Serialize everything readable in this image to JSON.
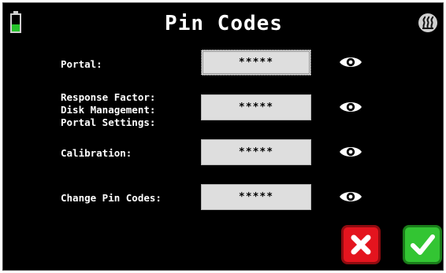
{
  "title": "Pin Codes",
  "status": {
    "battery_level_fraction": 0.45,
    "battery_color": "#26c22b"
  },
  "fields": [
    {
      "label": "Portal:",
      "value": "*****"
    },
    {
      "label": "Response Factor:\nDisk Management:\nPortal Settings:",
      "value": "*****"
    },
    {
      "label": "Calibration:",
      "value": "*****"
    },
    {
      "label": "Change Pin Codes:",
      "value": "*****"
    }
  ],
  "icons": {
    "battery": "battery-icon",
    "heater": "heater-icon",
    "reveal": "eye-icon",
    "cancel": "x-icon",
    "confirm": "check-icon"
  },
  "colors": {
    "background": "#000000",
    "cancel": "#e4141e",
    "confirm": "#33c533"
  }
}
